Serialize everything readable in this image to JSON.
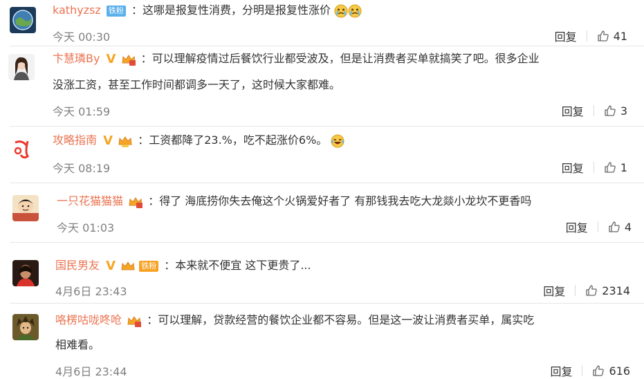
{
  "comments": [
    {
      "name": "kathyzsz",
      "badge": "铁粉",
      "text": "：这哪是报复性消费，分明是报复性涨价",
      "time": "今天 00:30",
      "reply": "回复",
      "likes": "41"
    },
    {
      "name": "卞慧璘By",
      "text_line1": "：可以理解疫情过后餐饮行业都受波及，但是让消费者买单就搞笑了吧。很多企业",
      "text_line2": "没涨工资，甚至工作时间都调多一天了，这时候大家都难。",
      "time": "今天 01:59",
      "reply": "回复",
      "likes": "3"
    },
    {
      "name": "攻略指南",
      "text": "：工资都降了23.%，吃不起涨价6%。",
      "time": "今天 08:19",
      "reply": "回复",
      "likes": "1"
    },
    {
      "name": "一只花猫猫猫",
      "text": "：得了 海底捞你失去俺这个火锅爱好者了 有那钱我去吃大龙燚小龙坎不更香吗",
      "time": "今天 01:03",
      "reply": "回复",
      "likes": "4"
    },
    {
      "name": "国民男友",
      "badge": "铁粉",
      "text": "：本来就不便宜 这下更贵了...",
      "time": "4月6日 23:43",
      "reply": "回复",
      "likes": "2314"
    },
    {
      "name": "咯楞咕咙咚呛",
      "text_line1": "：可以理解，贷款经营的餐饮企业都不容易。但是这一波让消费者买单，属实吃",
      "text_line2": "相难看。",
      "time": "4月6日 23:44",
      "reply": "回复",
      "likes": "616"
    }
  ],
  "colors": {
    "name": "#eb7350",
    "text": "#333333",
    "time": "#808080",
    "badge_blue": "#5ab0eb",
    "badge_orange": "#f7a225",
    "divider": "#e6e6e6"
  },
  "icons": [
    "like-icon",
    "crying-emoji-icon",
    "laughing-emoji-icon",
    "crown-icon",
    "verified-v-icon"
  ]
}
